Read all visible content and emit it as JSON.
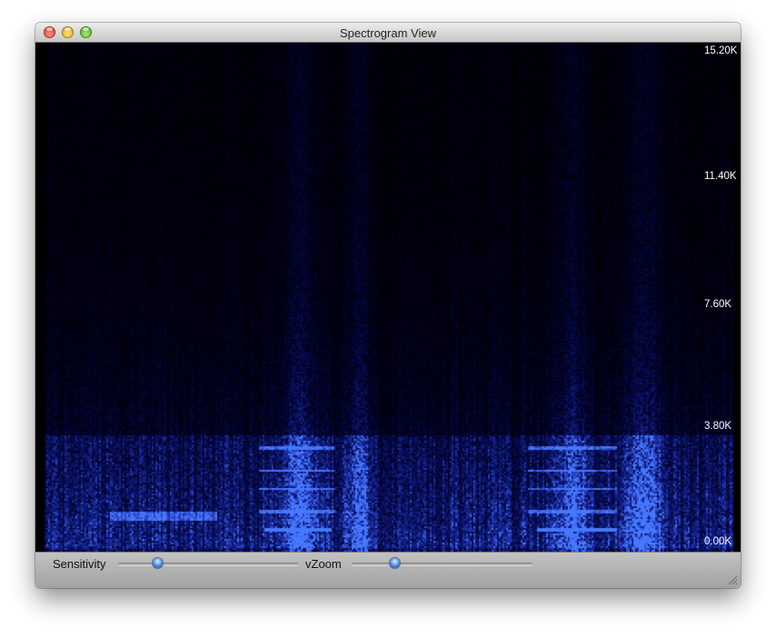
{
  "window": {
    "title": "Spectrogram View"
  },
  "spectrogram": {
    "y_axis_labels": [
      "15.20K",
      "11.40K",
      "7.60K",
      "3.80K",
      "0.00K"
    ],
    "colors": {
      "background": "#000000",
      "signal": "#3a55ff",
      "hot": "#48a8ff"
    }
  },
  "controls": {
    "sensitivity": {
      "label": "Sensitivity",
      "value": 0.22
    },
    "vzoom": {
      "label": "vZoom",
      "value": 0.24
    }
  },
  "icons": {
    "close": "close-icon",
    "minimize": "minimize-icon",
    "zoom": "zoom-icon",
    "resize": "resize-grip-icon"
  }
}
